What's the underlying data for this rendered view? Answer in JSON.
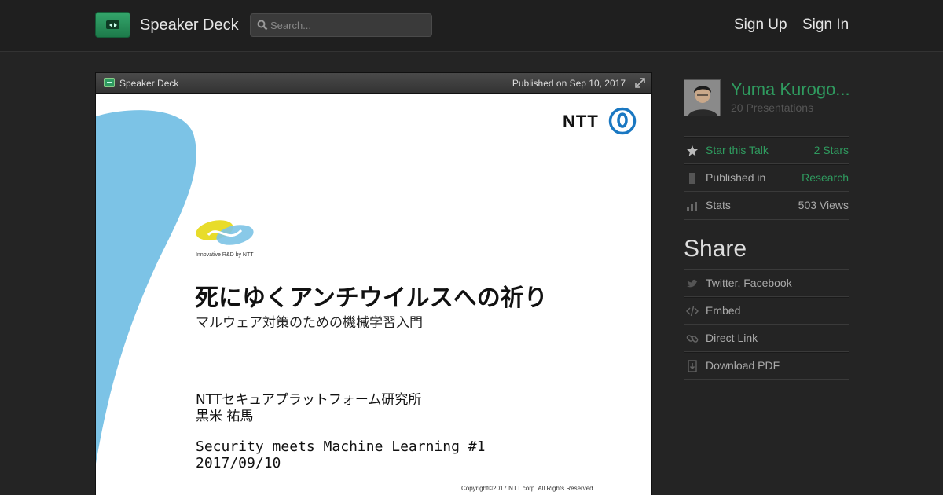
{
  "header": {
    "brand": "Speaker Deck",
    "search_placeholder": "Search...",
    "sign_up": "Sign Up",
    "sign_in": "Sign In"
  },
  "player": {
    "brand": "Speaker Deck",
    "published": "Published on Sep 10, 2017"
  },
  "slide": {
    "ntt_logo_text": "NTT",
    "rd_logo_text": "Innovative R&D by NTT",
    "title": "死にゆくアンチウイルスへの祈り",
    "subtitle": "マルウェア対策のための機械学習入門",
    "organization": "NTTセキュアプラットフォーム研究所",
    "author": "黒米 祐馬",
    "event": "Security meets Machine Learning #1",
    "date": "2017/09/10",
    "copyright": "Copyright©2017 NTT corp. All Rights Reserved."
  },
  "sidebar": {
    "author_name": "Yuma Kurogo...",
    "presentations": "20 Presentations",
    "star_label": "Star this Talk",
    "star_count": "2 Stars",
    "published_in_label": "Published in",
    "published_in_value": "Research",
    "stats_label": "Stats",
    "stats_value": "503 Views",
    "share_title": "Share",
    "share_items": [
      {
        "label": "Twitter, Facebook",
        "icon": "bird-icon"
      },
      {
        "label": "Embed",
        "icon": "code-icon"
      },
      {
        "label": "Direct Link",
        "icon": "link-icon"
      },
      {
        "label": "Download PDF",
        "icon": "download-icon"
      }
    ]
  },
  "colors": {
    "accent_green": "#2f9b5f",
    "background": "#242424",
    "slide_blue": "#7cc3e6"
  }
}
